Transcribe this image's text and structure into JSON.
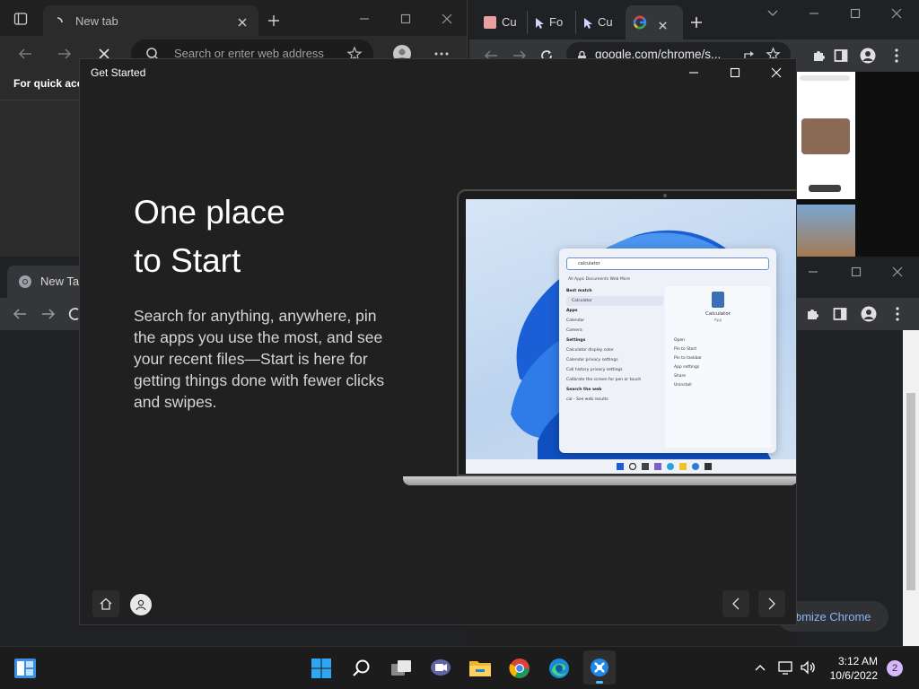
{
  "edge": {
    "tab_label": "New tab",
    "address_placeholder": "Search or enter web address",
    "favorites_text": "For quick acc"
  },
  "chrome_top": {
    "tabs": [
      "Cu",
      "Fo",
      "Cu"
    ],
    "address": "google.com/chrome/s..."
  },
  "chrome_bottom": {
    "tab_label": "New Tab",
    "customize_button": "omize Chrome"
  },
  "get_started": {
    "window_title": "Get Started",
    "headline_line1": "One place",
    "headline_line2": "to Start",
    "description": "Search for anything, anywhere, pin the apps you use the most, and see your recent files—Start is here for getting things done with fewer clicks and swipes.",
    "mock": {
      "search_text": "calculator",
      "tabs": "All   Apps   Documents   Web   More",
      "best_match": "Best match",
      "best_item": "Calculator",
      "apps_header": "Apps",
      "apps": [
        "Calendar",
        "Camera"
      ],
      "settings_header": "Settings",
      "settings": [
        "Calculator display color",
        "Calendar privacy settings",
        "Call history privacy settings",
        "Calibrate the screen for pen or touch"
      ],
      "web_header": "Search the web",
      "web_item": "cal - See web results",
      "right_app": "Calculator",
      "right_sub": "App",
      "actions": [
        "Open",
        "Pin to Start",
        "Pin to taskbar",
        "App settings",
        "Share",
        "Uninstall"
      ]
    }
  },
  "taskbar": {
    "time": "3:12 AM",
    "date": "10/6/2022",
    "notifications": "2"
  },
  "colors": {
    "accent_blue": "#4cc2ff",
    "win_blue": "#0a64d8",
    "edge_bg": "#2b2b2b",
    "chrome_bg": "#202124"
  }
}
